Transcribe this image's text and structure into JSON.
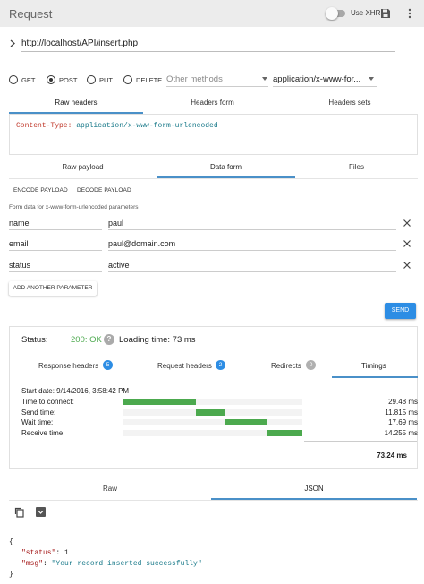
{
  "header": {
    "title": "Request",
    "xhr_label": "Use XHR"
  },
  "url": {
    "value": "http://localhost/API/insert.php"
  },
  "methods": {
    "options": [
      "GET",
      "POST",
      "PUT",
      "DELETE"
    ],
    "selected": "POST",
    "other_placeholder": "Other methods",
    "content_type": "application/x-www-for..."
  },
  "header_tabs": [
    "Raw headers",
    "Headers form",
    "Headers sets"
  ],
  "raw_headers": {
    "key": "Content-Type:",
    "value": " application/x-www-form-urlencoded"
  },
  "payload_tabs": [
    "Raw payload",
    "Data form",
    "Files"
  ],
  "payload_buttons": [
    "ENCODE PAYLOAD",
    "DECODE PAYLOAD"
  ],
  "form": {
    "caption": "Form data for x-www-form-urlencoded parameters",
    "params": [
      {
        "name": "name",
        "value": "paul"
      },
      {
        "name": "email",
        "value": "paul@domain.com"
      },
      {
        "name": "status",
        "value": "active"
      }
    ],
    "add_label": "ADD ANOTHER PARAMETER"
  },
  "send_label": "SEND",
  "response": {
    "status_label": "Status:",
    "status_value": "200: OK",
    "loading_label": "Loading time: 73 ms",
    "tabs": [
      {
        "label": "Response headers",
        "count": "5"
      },
      {
        "label": "Request headers",
        "count": "2"
      },
      {
        "label": "Redirects",
        "count": "0"
      },
      {
        "label": "Timings",
        "count": ""
      }
    ],
    "timings": {
      "start": "Start date: 9/14/2016, 3:58:42 PM",
      "rows": [
        {
          "label": "Time to connect:",
          "value": "29.48 ms",
          "ms": 29.48
        },
        {
          "label": "Send time:",
          "value": "11.815 ms",
          "ms": 11.815
        },
        {
          "label": "Wait time:",
          "value": "17.69 ms",
          "ms": 17.69
        },
        {
          "label": "Receive time:",
          "value": "14.255 ms",
          "ms": 14.255
        }
      ],
      "total": "73.24 ms",
      "total_ms": 73.24
    },
    "body_tabs": [
      "Raw",
      "JSON"
    ],
    "json_lines": [
      "{",
      "\"status\"",
      ": 1",
      "\"msg\"",
      ": ",
      "\"Your record inserted successfully\"",
      "}"
    ]
  },
  "colors": {
    "accent": "#2d8de4",
    "ok": "#4ca94e",
    "json_key": "#a31515",
    "json_string": "#1a7a8a"
  }
}
